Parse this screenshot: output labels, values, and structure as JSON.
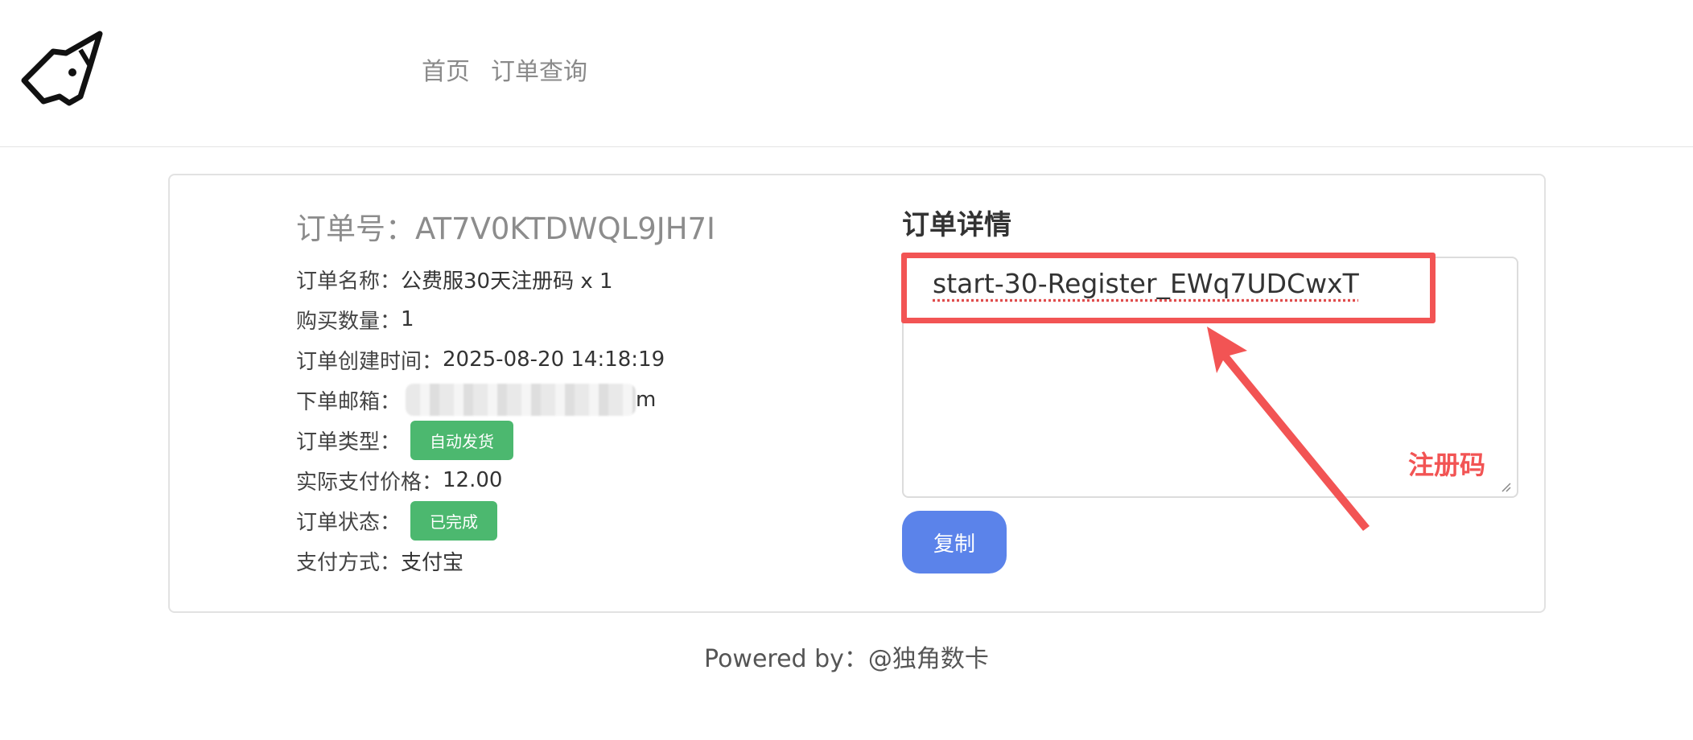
{
  "nav": {
    "items": [
      "首页",
      "订单查询"
    ]
  },
  "order": {
    "title_label": "订单号：",
    "title_value": "AT7V0KTDWQL9JH7I",
    "name_label": "订单名称：",
    "name_value": "公费服30天注册码 x 1",
    "qty_label": "购买数量：",
    "qty_value": "1",
    "created_label": "订单创建时间：",
    "created_value": "2025-08-20 14:18:19",
    "email_label": "下单邮箱：",
    "email_suffix": "m",
    "type_label": "订单类型：",
    "type_badge": "自动发货",
    "price_label": "实际支付价格：",
    "price_value": "12.00",
    "status_label": "订单状态：",
    "status_badge": "已完成",
    "payment_label": "支付方式：",
    "payment_value": "支付宝"
  },
  "detail": {
    "title": "订单详情",
    "content": "start-30-Register_EWq7UDCwxT",
    "copy_label": "复制"
  },
  "annotation": {
    "label": "注册码",
    "color": "#f25454"
  },
  "footer": {
    "text": "Powered by：@独角数卡"
  },
  "colors": {
    "badge_green": "#4cb86f",
    "copy_blue": "#5b83ea"
  }
}
